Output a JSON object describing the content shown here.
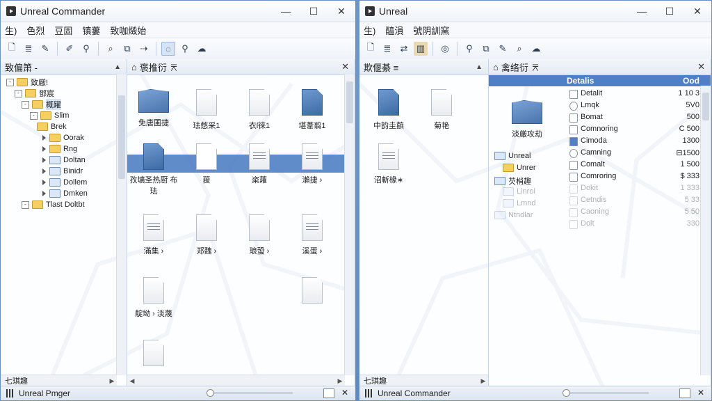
{
  "left_window": {
    "title": "Unreal Commander",
    "menu": [
      "生)",
      "色烈",
      "豆固",
      "镇蔞",
      "致咖燬始"
    ],
    "toolbar_icons": [
      "new-file-icon",
      "list-icon",
      "edit-icon",
      "pencil-icon",
      "search-icon",
      "magnify-icon",
      "copy-icon",
      "move-icon",
      "sync-icon",
      "zoom-icon",
      "network-icon"
    ],
    "tree_pane": {
      "header": "致偏箫 -",
      "nodes": [
        "致厳!",
        "鄧宸",
        "概躍",
        "Slim",
        "Brek",
        "Oorak",
        "Rng",
        "Doltan",
        "Binidr",
        "Dollem",
        "Dmken",
        "Tlast Doltbt"
      ],
      "footer": "七琪趣"
    },
    "file_pane": {
      "header": "褒推衍 ⌆",
      "files": [
        {
          "label": "免唐圃捷",
          "icon": "blue-folder-icon"
        },
        {
          "label": "珐憋采1",
          "icon": "document-icon"
        },
        {
          "label": "衣ſ徠1",
          "icon": "document-icon"
        },
        {
          "label": "堪葦翦1",
          "icon": "blue-document-icon"
        },
        {
          "label": "孜壙圣热㕑 布珐",
          "icon": "blue-document-icon"
        },
        {
          "label": "菝",
          "icon": "folder-icon"
        },
        {
          "label": "粢蕹",
          "icon": "text-document-icon"
        },
        {
          "label": "瀨捷 ›",
          "icon": "star-document-icon"
        },
        {
          "label": "滿集 ›",
          "icon": "edit-document-icon"
        },
        {
          "label": "郑魏 ›",
          "icon": "document-icon"
        },
        {
          "label": "琅蛩 ›",
          "icon": "document-icon"
        },
        {
          "label": "溪蛋 ›",
          "icon": "edit-document-icon"
        },
        {
          "label": "靛坳 › 淡蔑",
          "icon": "document-icon"
        },
        {
          "label": "",
          "icon": "document-icon"
        },
        {
          "label": "",
          "icon": "document-icon"
        }
      ]
    },
    "status": "Unreal Pmger"
  },
  "right_window": {
    "title": "Unreal",
    "menu": [
      "生)",
      "醯溳",
      "號阴訓窯"
    ],
    "toolbar_icons": [
      "new-file-icon",
      "list-icon",
      "transfer-icon",
      "chart-icon",
      "target-icon",
      "search-icon",
      "copy-icon",
      "edit-icon",
      "magnify-icon",
      "network-icon"
    ],
    "tree_pane": {
      "header": "欺偃綦 ≡",
      "files": [
        {
          "label": "中韵圭蕻",
          "icon": "blue-document-icon"
        },
        {
          "label": "菊艳",
          "icon": "document-icon"
        },
        {
          "label": "沼斬椽∗",
          "icon": "text-document-icon"
        }
      ],
      "footer": "七琪趣"
    },
    "details_pane": {
      "header": "禽络衍 ⌆",
      "columns": {
        "name": "Detalis",
        "size": "Ood"
      },
      "left_items": [
        {
          "label": "淡厳攻劫",
          "icon": "blue-folder-icon"
        },
        {
          "label": "Unreal",
          "icon": "folder-icon"
        },
        {
          "label": "Unrer",
          "icon": "folder-icon"
        },
        {
          "label": "芡梢趣",
          "icon": "folder-icon"
        },
        {
          "label": "Linrol",
          "icon": "folder-icon"
        },
        {
          "label": "Lmnd",
          "icon": "folder-icon"
        },
        {
          "label": "Ntndlar",
          "icon": "folder-icon"
        }
      ],
      "rows": [
        {
          "name": "Detalit",
          "size": "1 10 3"
        },
        {
          "name": "Lmqk",
          "size": "5V0"
        },
        {
          "name": "Bomat",
          "size": "500"
        },
        {
          "name": "Comnoring",
          "size": "C 500"
        },
        {
          "name": "Cimoda",
          "size": "1300"
        },
        {
          "name": "Camning",
          "size": "⊟1500"
        },
        {
          "name": "Comalt",
          "size": "1 500"
        },
        {
          "name": "Comroring",
          "size": "$ 333"
        },
        {
          "name": "Dokit",
          "size": "1 333"
        },
        {
          "name": "Cetndis",
          "size": "5 33"
        },
        {
          "name": "Caoning",
          "size": "5 50"
        },
        {
          "name": "Dolt",
          "size": "330"
        }
      ]
    },
    "status": "Unreal Commander"
  }
}
